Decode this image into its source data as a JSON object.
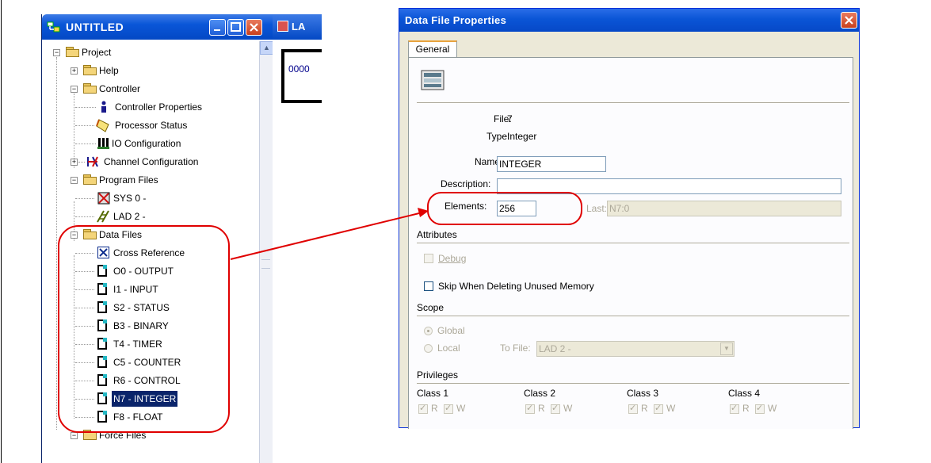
{
  "left_window": {
    "title": "UNTITLED",
    "tree": [
      {
        "label": "Project"
      },
      {
        "label": "Help"
      },
      {
        "label": "Controller"
      },
      {
        "label": "Controller Properties"
      },
      {
        "label": "Processor Status"
      },
      {
        "label": "IO Configuration"
      },
      {
        "label": "Channel Configuration"
      },
      {
        "label": "Program Files"
      },
      {
        "label": "SYS 0 -"
      },
      {
        "label": "LAD 2 -"
      },
      {
        "label": "Data Files"
      },
      {
        "label": "Cross Reference"
      },
      {
        "label": "O0 - OUTPUT"
      },
      {
        "label": "I1 - INPUT"
      },
      {
        "label": "S2 - STATUS"
      },
      {
        "label": "B3 - BINARY"
      },
      {
        "label": "T4 - TIMER"
      },
      {
        "label": "C5 - COUNTER"
      },
      {
        "label": "R6 - CONTROL"
      },
      {
        "label": "N7 - INTEGER",
        "selected": true
      },
      {
        "label": "F8 - FLOAT"
      },
      {
        "label": "Force Files"
      }
    ]
  },
  "ladder_window": {
    "title": "LA",
    "rung_number": "0000"
  },
  "dialog": {
    "title": "Data File Properties",
    "tab_general": "General",
    "file_label": "File:",
    "file_value": "7",
    "type_label": "Type:",
    "type_value": "Integer",
    "name_label": "Name:",
    "name_value": "INTEGER",
    "description_label": "Description:",
    "description_value": "",
    "elements_label": "Elements:",
    "elements_value": "256",
    "last_label": "Last:",
    "last_value": "N7:0",
    "attributes_header": "Attributes",
    "debug_label": "Debug",
    "skip_label": "Skip When Deleting Unused Memory",
    "scope_header": "Scope",
    "global_label": "Global",
    "local_label": "Local",
    "to_file_label": "To File:",
    "to_file_value": "LAD 2 -",
    "privileges_header": "Privileges",
    "class1": "Class 1",
    "class2": "Class 2",
    "class3": "Class 3",
    "class4": "Class 4",
    "r_label": "R",
    "w_label": "W"
  },
  "colors": {
    "annotation": "#e00000",
    "title_blue": "#0a55d6",
    "dialog_bg": "#ece9d8"
  }
}
